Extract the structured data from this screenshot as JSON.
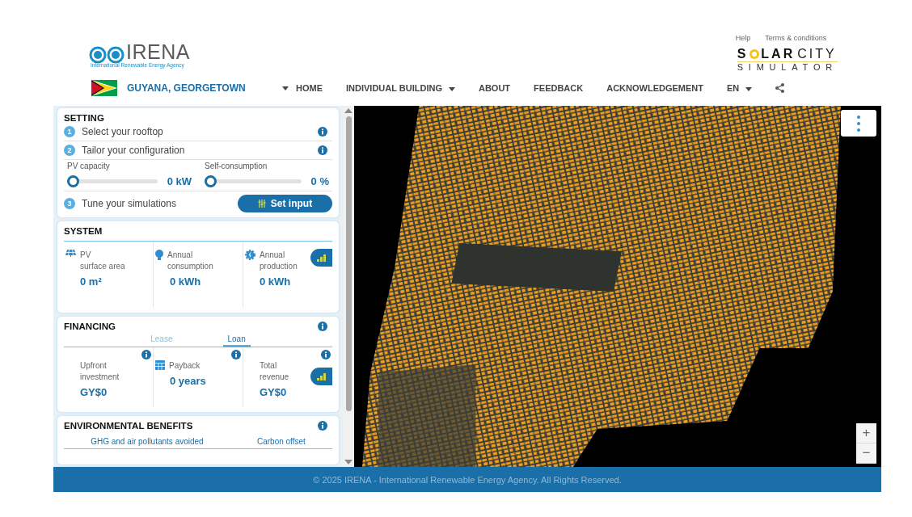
{
  "header": {
    "logo": {
      "name": "IRENA",
      "subtitle": "International Renewable Energy Agency"
    },
    "top_links": [
      "Help",
      "Terms & conditions"
    ],
    "brand": {
      "first": "S",
      "second": "LAR",
      "third": "CITY",
      "tagline": "SIMULATOR"
    },
    "location": {
      "label": "GUYANA, GEORGETOWN"
    },
    "nav": [
      {
        "label": "HOME",
        "dropdown": false
      },
      {
        "label": "INDIVIDUAL BUILDING",
        "dropdown": true
      },
      {
        "label": "ABOUT",
        "dropdown": false
      },
      {
        "label": "FEEDBACK",
        "dropdown": false
      },
      {
        "label": "ACKNOWLEDGEMENT",
        "dropdown": false
      },
      {
        "label": "EN",
        "dropdown": true
      }
    ]
  },
  "setting": {
    "title": "SETTING",
    "steps": [
      {
        "number": "1",
        "label": "Select your rooftop",
        "info": true
      },
      {
        "number": "2",
        "label": "Tailor your configuration",
        "info": true
      },
      {
        "number": "3",
        "label": "Tune your simulations",
        "info": false
      }
    ],
    "sliders": [
      {
        "label": "PV capacity",
        "level": 0,
        "reading": "0 kW"
      },
      {
        "label": "Self-consumption",
        "level": 0,
        "reading": "0 %"
      }
    ],
    "button": "Set input"
  },
  "system": {
    "title": "SYSTEM",
    "stats": [
      {
        "kind": "panel",
        "label": "PV\nsurface area",
        "value": "0 m²"
      },
      {
        "kind": "bulb",
        "label": "Annual\nconsumption",
        "value": "0 kWh"
      },
      {
        "kind": "gear",
        "label": "Annual\nproduction",
        "value": "0 kWh"
      }
    ]
  },
  "financing": {
    "title": "FINANCING",
    "tabs": [
      {
        "label": "Lease",
        "selected": false
      },
      {
        "label": "Loan",
        "selected": true
      }
    ],
    "stats": [
      {
        "kind": "plain",
        "label": "Upfront\ninvestment",
        "value": "GY$0"
      },
      {
        "kind": "calendar",
        "label": "Payback",
        "value": "0 years"
      },
      {
        "kind": "plain",
        "label": "Total\nrevenue",
        "value": "GY$0"
      }
    ]
  },
  "environmental": {
    "title": "ENVIRONMENTAL BENEFITS",
    "columns": [
      "GHG and air pollutants avoided",
      "Carbon offset"
    ]
  },
  "map": {
    "zoom_in": "+",
    "zoom_out": "−"
  },
  "footer": "© 2025 IRENA - International Renewable Energy Agency. All Rights Reserved."
}
